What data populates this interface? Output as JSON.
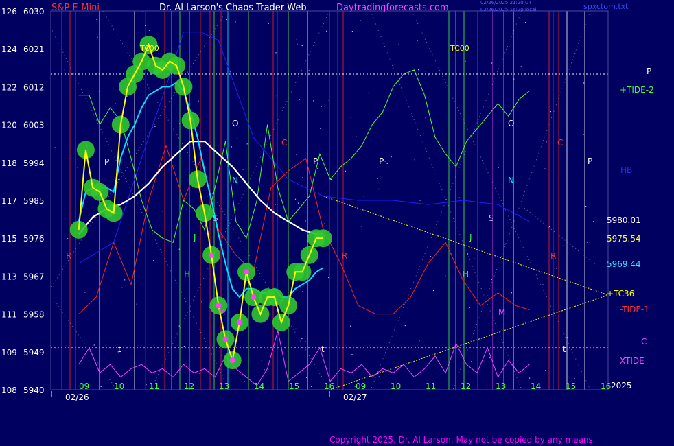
{
  "header": {
    "instrument": "S&P E-Mini",
    "site_title": "Dr. Al Larson's Chaos Trader Web",
    "site_url": "Daytradingforecasts.com",
    "stamp_line1": "02/26/2025 21:20 UT",
    "stamp_line2": "02/26/2025 16:20 local",
    "source_file": "spxctom.txt"
  },
  "copyright": "Copyright 2025, Dr. Al Larson. May not be copied by any means.",
  "colors": {
    "background": "#000060",
    "price": "#ffff00",
    "ema_fast": "#00e0ff",
    "ema_slow": "#ffffff",
    "tide_plus2": "#40ff40",
    "tide_minus1": "#ff2020",
    "xtide": "#ff40ff",
    "hb": "#2020ff",
    "vertical_white": "#ffffff",
    "vertical_red": "#ff2020",
    "vertical_green": "#40ff40"
  },
  "right_labels": {
    "p": "P",
    "tide_plus2": "+TIDE-2",
    "hb": "HB",
    "level_1": "5980.01",
    "level_2": "5975.54",
    "level_3": "5969.44",
    "cluster": "+TC36",
    "tide_minus1": "-TIDE-1",
    "c": "C",
    "xtide": "XTIDE",
    "year": "2025"
  },
  "chart_data": {
    "type": "line",
    "title": "S&P E-Mini",
    "y_left_labels": [
      "126",
      "124",
      "122",
      "120",
      "118",
      "117",
      "115",
      "113",
      "111",
      "109",
      "108"
    ],
    "y_price_labels": [
      "6030",
      "6021",
      "6012",
      "6003",
      "5994",
      "5985",
      "5976",
      "5967",
      "5958",
      "5949",
      "5940"
    ],
    "ylim": [
      5940,
      6030
    ],
    "x_hour_labels": [
      "09",
      "10",
      "11",
      "12",
      "13",
      "14",
      "15",
      "16",
      "09",
      "10",
      "11",
      "12",
      "13",
      "14",
      "15",
      "16"
    ],
    "x_date_labels": [
      "02/26",
      "02/27"
    ],
    "annotations": {
      "tc": [
        "TC00",
        "TC00"
      ],
      "markers": [
        "P",
        "O",
        "C",
        "P",
        "P",
        "O",
        "C",
        "P",
        "N",
        "N",
        "R",
        "R",
        "R",
        "H",
        "H",
        "M",
        "M",
        "S",
        "S",
        "J",
        "J",
        "t",
        "t",
        "t"
      ]
    },
    "horizontal_levels": [
      6015,
      5950
    ],
    "projection_level": 5962.5,
    "series": [
      {
        "name": "price",
        "x": [
          9.0,
          9.2,
          9.4,
          9.6,
          9.8,
          10.0,
          10.2,
          10.4,
          10.6,
          10.8,
          11.0,
          11.2,
          11.4,
          11.6,
          11.8,
          12.0,
          12.2,
          12.4,
          12.6,
          12.8,
          13.0,
          13.2,
          13.4,
          13.6,
          13.8,
          14.0,
          14.2,
          14.4,
          14.6,
          14.8,
          15.0,
          15.2,
          15.4,
          15.6,
          15.8,
          16.0
        ],
        "values": [
          5978,
          5997,
          5988,
          5987,
          5983,
          5982,
          6003,
          6012,
          6015,
          6018,
          6022,
          6017,
          6016,
          6018,
          6017,
          6012,
          6004,
          5990,
          5982,
          5972,
          5960,
          5952,
          5947,
          5956,
          5968,
          5962,
          5958,
          5962,
          5962,
          5956,
          5960,
          5968,
          5968,
          5972,
          5976,
          5976
        ]
      },
      {
        "name": "fast average",
        "x": [
          9.0,
          9.2,
          9.4,
          9.6,
          9.8,
          10.0,
          10.2,
          10.4,
          10.6,
          10.8,
          11.0,
          11.2,
          11.4,
          11.6,
          11.8,
          12.0,
          12.2,
          12.4,
          12.6,
          12.8,
          13.0,
          13.2,
          13.4,
          13.6,
          13.8,
          14.0,
          14.2,
          14.4,
          14.6,
          14.8,
          15.0,
          15.2,
          15.4,
          15.6,
          15.8,
          16.0
        ],
        "values": [
          5980,
          5987,
          5988,
          5988,
          5988,
          5987,
          5995,
          6000,
          6003,
          6007,
          6010,
          6011,
          6012,
          6012,
          6013,
          6011,
          6006,
          6000,
          5992,
          5985,
          5977,
          5970,
          5964,
          5962,
          5964,
          5964,
          5963,
          5963,
          5964,
          5962,
          5962,
          5964,
          5965,
          5966,
          5968,
          5969
        ]
      },
      {
        "name": "slow average",
        "x": [
          9.0,
          9.4,
          9.8,
          10.2,
          10.6,
          11.0,
          11.4,
          11.8,
          12.2,
          12.6,
          13.0,
          13.4,
          13.8,
          14.2,
          14.6,
          15.0,
          15.4,
          15.8,
          16.0
        ],
        "values": [
          5977,
          5981,
          5983,
          5984,
          5986,
          5989,
          5993,
          5996,
          5999,
          5999,
          5996,
          5993,
          5989,
          5985,
          5982,
          5980,
          5978,
          5977,
          5977
        ]
      },
      {
        "name": "+TIDE-2",
        "x": [
          9.0,
          9.3,
          9.6,
          9.9,
          10.2,
          10.5,
          10.8,
          11.1,
          11.4,
          11.7,
          12.0,
          12.3,
          12.6,
          12.9,
          13.2,
          13.5,
          13.8,
          14.1,
          14.4,
          14.7,
          15.0,
          15.3,
          15.6,
          15.9,
          16.2,
          16.5,
          16.8,
          17.1,
          17.4,
          17.7,
          18.0,
          18.3,
          18.6,
          18.9,
          19.2,
          19.5,
          19.8,
          20.1,
          20.4,
          20.7,
          21.0,
          21.3,
          21.6,
          21.9
        ],
        "values": [
          6010,
          6010,
          6003,
          6007,
          6004,
          5995,
          5985,
          5978,
          5976,
          5975,
          5985,
          5983,
          5978,
          5988,
          5999,
          5980,
          5976,
          5985,
          6003,
          5988,
          5980,
          5983,
          5986,
          5996,
          5990,
          5993,
          5995,
          5998,
          6003,
          6006,
          6012,
          6015,
          6016,
          6010,
          6000,
          5996,
          5993,
          5999,
          6002,
          6005,
          6008,
          6005,
          6009,
          6011
        ]
      },
      {
        "name": "-TIDE-1",
        "x": [
          9.0,
          9.5,
          10.0,
          10.5,
          11.0,
          11.5,
          12.0,
          12.5,
          13.0,
          13.5,
          14.0,
          14.5,
          15.0,
          15.5,
          16.0,
          16.5,
          17.0,
          17.5,
          18.0,
          18.5,
          19.0,
          19.5,
          20.0,
          20.5,
          21.0,
          21.5,
          21.9
        ],
        "values": [
          5958,
          5962,
          5975,
          5965,
          5985,
          5998,
          5985,
          5995,
          5978,
          5972,
          5968,
          5988,
          5992,
          5995,
          5978,
          5970,
          5960,
          5958,
          5958,
          5962,
          5970,
          5975,
          5966,
          5960,
          5963,
          5960,
          5959
        ]
      },
      {
        "name": "XTIDE",
        "x": [
          9.0,
          9.3,
          9.6,
          9.9,
          10.2,
          10.5,
          10.8,
          11.1,
          11.4,
          11.7,
          12.0,
          12.3,
          12.6,
          12.9,
          13.2,
          13.5,
          13.8,
          14.1,
          14.4,
          14.7,
          15.0,
          15.3,
          15.6,
          15.9,
          16.2,
          16.5,
          16.8,
          17.1,
          17.4,
          17.7,
          18.0,
          18.3,
          18.6,
          18.9,
          19.2,
          19.5,
          19.8,
          20.1,
          20.4,
          20.7,
          21.0,
          21.3,
          21.6,
          21.9
        ],
        "values": [
          5946,
          5950,
          5944,
          5946,
          5943,
          5945,
          5946,
          5944,
          5945,
          5943,
          5946,
          5944,
          5945,
          5943,
          5948,
          5945,
          5943,
          5941,
          5945,
          5954,
          5942,
          5944,
          5946,
          5950,
          5942,
          5945,
          5944,
          5946,
          5943,
          5945,
          5944,
          5946,
          5943,
          5945,
          5948,
          5944,
          5951,
          5946,
          5944,
          5950,
          5943,
          5947,
          5944,
          5946
        ]
      },
      {
        "name": "HB",
        "x": [
          9.0,
          10.0,
          11.0,
          11.5,
          12.0,
          12.5,
          13.0,
          14.0,
          15.0,
          16.0,
          17.0,
          18.0,
          19.0,
          20.0,
          21.0,
          21.9
        ],
        "values": [
          5970,
          5975,
          6000,
          6012,
          6025,
          6025,
          6023,
          6000,
          5990,
          5986,
          5985,
          5985,
          5984,
          5985,
          5984,
          5980
        ]
      }
    ]
  }
}
